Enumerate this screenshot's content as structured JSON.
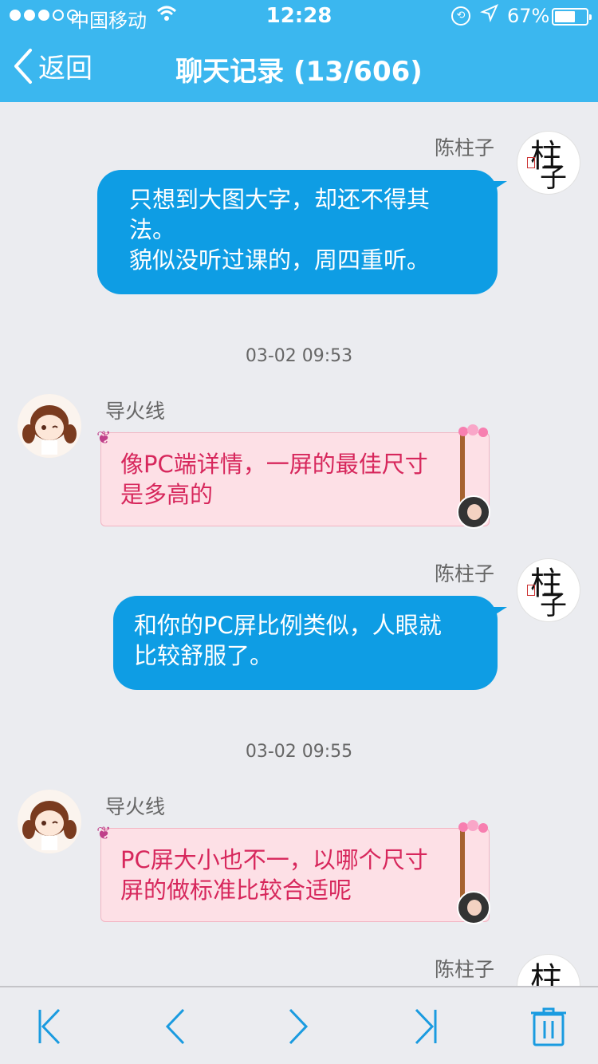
{
  "status_bar": {
    "carrier": "中国移动",
    "time": "12:28",
    "battery": "67%",
    "battery_level": 0.67
  },
  "nav": {
    "back_label": "返回",
    "title": "聊天记录 (13/606)"
  },
  "messages": [
    {
      "sender": "陈柱子",
      "side": "right",
      "text": "只想到大图大字，却还不得其\n法。\n貌似没听过课的，周四重听。"
    },
    {
      "timestamp": "03-02 09:53"
    },
    {
      "sender": "导火线",
      "side": "left",
      "text": "像PC端详情，一屏的最佳尺寸\n是多高的"
    },
    {
      "sender": "陈柱子",
      "side": "right",
      "text": "和你的PC屏比例类似，人眼就\n比较舒服了。"
    },
    {
      "timestamp": "03-02 09:55"
    },
    {
      "sender": "导火线",
      "side": "left",
      "text": "PC屏大小也不一，以哪个尺寸\n屏的做标准比较合适呢"
    },
    {
      "sender": "陈柱子",
      "side": "right",
      "text": ""
    }
  ],
  "avatar_right_glyphs": [
    "柱",
    "子"
  ],
  "toolbar": {
    "buttons": [
      "first-page",
      "previous-page",
      "next-page",
      "last-page",
      "delete"
    ]
  },
  "colors": {
    "header": "#3bb7ef",
    "outgoing_bubble": "#0e9de4",
    "incoming_bubble": "#fde0e6",
    "incoming_text": "#d7275c",
    "toolbar_icon": "#1a9be0"
  }
}
